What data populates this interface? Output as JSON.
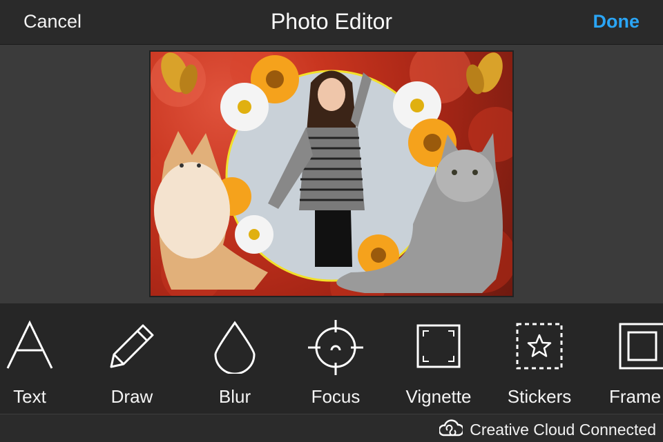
{
  "header": {
    "cancel_label": "Cancel",
    "title": "Photo Editor",
    "done_label": "Done",
    "accent_color": "#2aa5f5"
  },
  "photo": {
    "subject": "collage with woman in circular yellow frame, two cats, orange and white flowers, butterflies on red rose background"
  },
  "tools": [
    {
      "label": "Text",
      "icon": "text-icon"
    },
    {
      "label": "Draw",
      "icon": "pencil-icon"
    },
    {
      "label": "Blur",
      "icon": "drop-icon"
    },
    {
      "label": "Focus",
      "icon": "crosshair-icon"
    },
    {
      "label": "Vignette",
      "icon": "vignette-icon"
    },
    {
      "label": "Stickers",
      "icon": "star-icon"
    },
    {
      "label": "Frame",
      "icon": "frame-icon"
    }
  ],
  "footer": {
    "status": "Creative Cloud Connected",
    "icon": "creative-cloud-icon"
  }
}
